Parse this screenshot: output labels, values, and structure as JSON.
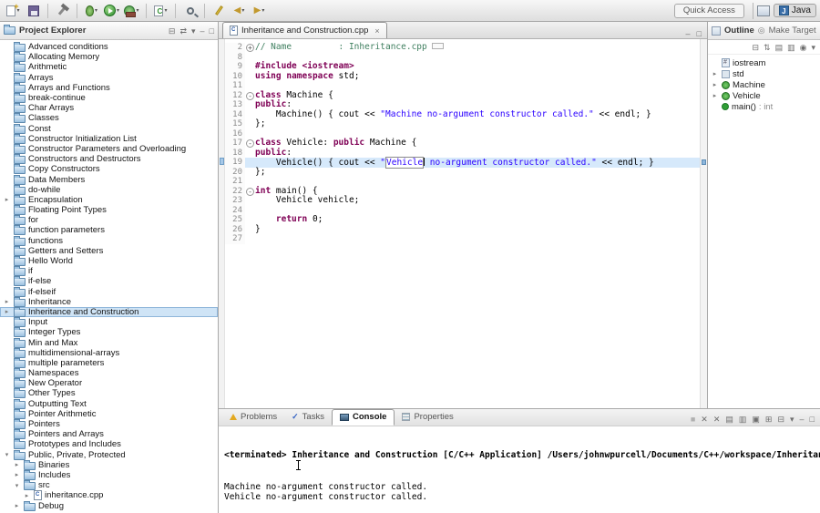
{
  "toolbar": {
    "quick_access_label": "Quick Access",
    "perspective_label": "Java",
    "items": [
      {
        "name": "new-wizard",
        "kind": "new",
        "dropdown": true
      },
      {
        "name": "save",
        "kind": "save"
      },
      {
        "sep": true
      },
      {
        "name": "build",
        "kind": "hammer"
      },
      {
        "sep": true
      },
      {
        "name": "debug",
        "kind": "debug",
        "dropdown": true
      },
      {
        "name": "run",
        "kind": "run",
        "dropdown": true
      },
      {
        "name": "external-tools",
        "kind": "tools",
        "dropdown": true
      },
      {
        "sep": true
      },
      {
        "name": "new-cpp-class",
        "kind": "newclass",
        "dropdown": true
      },
      {
        "sep": true
      },
      {
        "name": "search",
        "kind": "search"
      },
      {
        "sep": true
      },
      {
        "name": "last-edit-location",
        "kind": "lastedit"
      },
      {
        "name": "back",
        "kind": "back",
        "dropdown": true
      },
      {
        "name": "forward",
        "kind": "forward",
        "dropdown": true
      }
    ]
  },
  "project_explorer": {
    "title": "Project Explorer",
    "header_icons": [
      {
        "name": "collapse-all-icon",
        "glyph": "⊟"
      },
      {
        "name": "link-with-editor-icon",
        "glyph": "⇄"
      },
      {
        "name": "view-menu-icon",
        "glyph": "▾"
      },
      {
        "name": "minimize-icon",
        "glyph": "–"
      },
      {
        "name": "maximize-icon",
        "glyph": "□"
      }
    ],
    "items": [
      {
        "label": "Advanced conditions"
      },
      {
        "label": "Allocating Memory"
      },
      {
        "label": "Arithmetic"
      },
      {
        "label": "Arrays"
      },
      {
        "label": "Arrays and Functions"
      },
      {
        "label": "break-continue"
      },
      {
        "label": "Char Arrays"
      },
      {
        "label": "Classes"
      },
      {
        "label": "Const"
      },
      {
        "label": "Constructor Initialization List"
      },
      {
        "label": "Constructor Parameters and Overloading"
      },
      {
        "label": "Constructors and Destructors"
      },
      {
        "label": "Copy Constructors"
      },
      {
        "label": "Data Members"
      },
      {
        "label": "do-while"
      },
      {
        "label": "Encapsulation",
        "arrow": "right"
      },
      {
        "label": "Floating Point Types"
      },
      {
        "label": "for"
      },
      {
        "label": "function parameters"
      },
      {
        "label": "functions"
      },
      {
        "label": "Getters and Setters"
      },
      {
        "label": "Hello World"
      },
      {
        "label": "if"
      },
      {
        "label": "if-else"
      },
      {
        "label": "if-elseif"
      },
      {
        "label": "Inheritance",
        "arrow": "right"
      },
      {
        "label": "Inheritance and Construction",
        "arrow": "right",
        "selected": true
      },
      {
        "label": "Input"
      },
      {
        "label": "Integer Types"
      },
      {
        "label": "Min and Max"
      },
      {
        "label": "multidimensional-arrays"
      },
      {
        "label": "multiple parameters"
      },
      {
        "label": "Namespaces"
      },
      {
        "label": "New Operator"
      },
      {
        "label": "Other Types"
      },
      {
        "label": "Outputting Text"
      },
      {
        "label": "Pointer Arithmetic"
      },
      {
        "label": "Pointers"
      },
      {
        "label": "Pointers and Arrays"
      },
      {
        "label": "Prototypes and Includes"
      },
      {
        "label": "Public, Private, Protected",
        "arrow": "down"
      },
      {
        "label": "Binaries",
        "depth": 1,
        "arrow": "right"
      },
      {
        "label": "Includes",
        "depth": 1,
        "arrow": "right"
      },
      {
        "label": "src",
        "depth": 1,
        "arrow": "down"
      },
      {
        "label": "inheritance.cpp",
        "depth": 2,
        "arrow": "right",
        "icon": "cppfile"
      },
      {
        "label": "Debug",
        "depth": 1,
        "arrow": "right"
      }
    ]
  },
  "editor": {
    "tab_label": "Inheritance and Construction.cpp",
    "close_glyph": "×",
    "window_icons": [
      {
        "name": "minimize-icon",
        "glyph": "–"
      },
      {
        "name": "maximize-icon",
        "glyph": "□"
      }
    ],
    "lines": [
      {
        "num": "2",
        "fold": "+",
        "tokens": [
          [
            "c",
            "// Name         : Inheritance.cpp"
          ],
          [
            "foldbox",
            ""
          ]
        ]
      },
      {
        "num": "8",
        "tokens": []
      },
      {
        "num": "9",
        "tokens": [
          [
            "k",
            "#include <iostream>"
          ]
        ]
      },
      {
        "num": "10",
        "tokens": [
          [
            "k",
            "using"
          ],
          [
            "p",
            " "
          ],
          [
            "k",
            "namespace"
          ],
          [
            "p",
            " std;"
          ]
        ]
      },
      {
        "num": "11",
        "tokens": []
      },
      {
        "num": "12",
        "fold": "-",
        "tokens": [
          [
            "k",
            "class"
          ],
          [
            "p",
            " Machine {"
          ]
        ]
      },
      {
        "num": "13",
        "tokens": [
          [
            "k",
            "public"
          ],
          [
            "p",
            ":"
          ]
        ]
      },
      {
        "num": "14",
        "tokens": [
          [
            "p",
            "    Machine() { cout << "
          ],
          [
            "s",
            "\"Machine no-argument constructor called.\""
          ],
          [
            "p",
            " << endl; }"
          ]
        ]
      },
      {
        "num": "15",
        "tokens": [
          [
            "p",
            "};"
          ]
        ]
      },
      {
        "num": "16",
        "tokens": []
      },
      {
        "num": "17",
        "fold": "-",
        "tokens": [
          [
            "k",
            "class"
          ],
          [
            "p",
            " Vehicle: "
          ],
          [
            "k",
            "public"
          ],
          [
            "p",
            " Machine {"
          ]
        ]
      },
      {
        "num": "18",
        "tokens": [
          [
            "k",
            "public"
          ],
          [
            "p",
            ":"
          ]
        ]
      },
      {
        "num": "19",
        "hl": true,
        "tokens": [
          [
            "p",
            "    Vehicle() { cout << "
          ],
          [
            "s",
            "\""
          ],
          [
            "box",
            "Vehicle"
          ],
          [
            "caret",
            ""
          ],
          [
            "s",
            " no-argument constructor called.\""
          ],
          [
            "p",
            " << endl; }"
          ]
        ]
      },
      {
        "num": "20",
        "tokens": [
          [
            "p",
            "};"
          ]
        ]
      },
      {
        "num": "21",
        "tokens": []
      },
      {
        "num": "22",
        "fold": "-",
        "tokens": [
          [
            "k",
            "int"
          ],
          [
            "p",
            " main() {"
          ]
        ]
      },
      {
        "num": "23",
        "tokens": [
          [
            "p",
            "    Vehicle vehicle;"
          ]
        ]
      },
      {
        "num": "24",
        "tokens": []
      },
      {
        "num": "25",
        "tokens": [
          [
            "p",
            "    "
          ],
          [
            "k",
            "return"
          ],
          [
            "p",
            " 0;"
          ]
        ]
      },
      {
        "num": "26",
        "tokens": [
          [
            "p",
            "}"
          ]
        ]
      },
      {
        "num": "27",
        "tokens": []
      }
    ]
  },
  "outline": {
    "title": "Outline",
    "secondary_tab": "Make Target",
    "toolbar_icons": [
      {
        "name": "collapse-all-icon",
        "glyph": "⊟"
      },
      {
        "name": "sort-icon",
        "glyph": "⇅"
      },
      {
        "name": "hide-fields-icon",
        "glyph": "▤"
      },
      {
        "name": "hide-static-members-icon",
        "glyph": "▥"
      },
      {
        "name": "hide-non-public-icon",
        "glyph": "◉"
      },
      {
        "name": "view-menu-icon",
        "glyph": "▾"
      }
    ],
    "items": [
      {
        "label": "iostream",
        "icon": "include"
      },
      {
        "label": "std",
        "icon": "namespace",
        "arrow": true
      },
      {
        "label": "Machine",
        "icon": "class",
        "arrow": true
      },
      {
        "label": "Vehicle",
        "icon": "class",
        "arrow": true
      },
      {
        "label": "main()",
        "rtype": " : int",
        "icon": "method"
      }
    ]
  },
  "console": {
    "tabs": [
      {
        "label": "Problems",
        "icon": "problems"
      },
      {
        "label": "Tasks",
        "icon": "tasks"
      },
      {
        "label": "Console",
        "icon": "console",
        "active": true
      },
      {
        "label": "Properties",
        "icon": "properties"
      }
    ],
    "toolbar_icons": [
      {
        "name": "terminate-icon",
        "glyph": "■",
        "color": "#b0b0b0"
      },
      {
        "name": "remove-launch-icon",
        "glyph": "✕"
      },
      {
        "name": "remove-all-launches-icon",
        "glyph": "✕"
      },
      {
        "name": "clear-console-icon",
        "glyph": "▤"
      },
      {
        "name": "scroll-lock-icon",
        "glyph": "▥"
      },
      {
        "name": "pin-console-icon",
        "glyph": "▣"
      },
      {
        "name": "display-selected-console-icon",
        "glyph": "⊞"
      },
      {
        "name": "open-console-icon",
        "glyph": "⊟"
      },
      {
        "name": "console-menu-icon",
        "glyph": "▾"
      },
      {
        "name": "minimize-icon",
        "glyph": "–"
      },
      {
        "name": "maximize-icon",
        "glyph": "□"
      }
    ],
    "header_line": "<terminated> Inheritance and Construction [C/C++ Application] /Users/johnwpurcell/Documents/C++/workspace/Inheritance and Construction/Debug/Inheritance and Construction",
    "output_lines": [
      "Machine no-argument constructor called.",
      "Vehicle no-argument constructor called."
    ]
  }
}
